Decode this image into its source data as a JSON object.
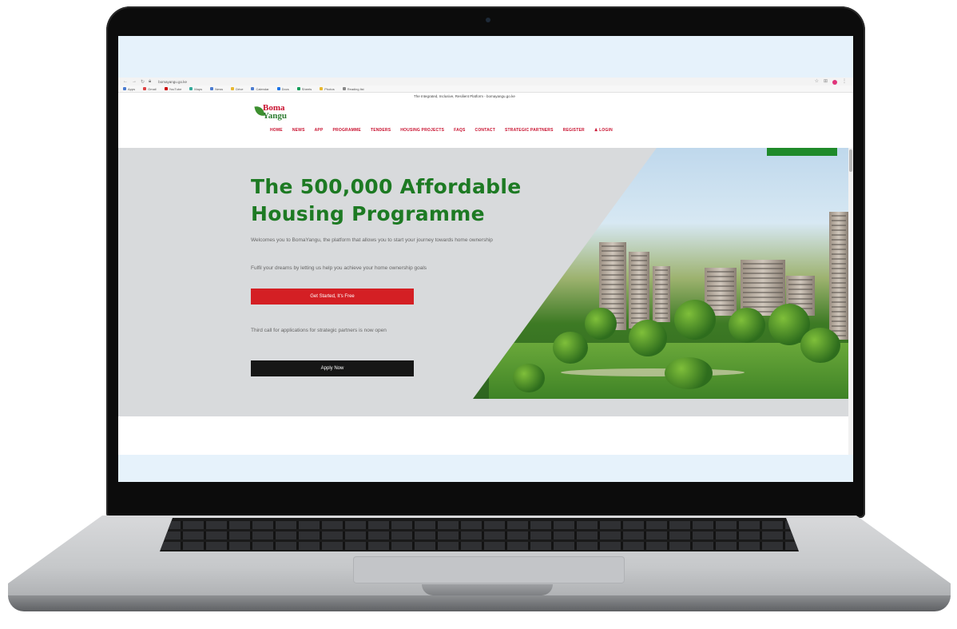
{
  "browser": {
    "url": "bomayangu.go.ke",
    "bookmarks": [
      "Apps",
      "Gmail",
      "YouTube",
      "Maps",
      "News",
      "Drive",
      "Calendar",
      "Docs",
      "Sheets",
      "Photos",
      "Reading list"
    ]
  },
  "site": {
    "announcement": "The Integrated, Inclusive, Resilient Platform - bomayangu.go.ke",
    "logo": {
      "line1": "Boma",
      "line2": "Yangu"
    },
    "nav": [
      "HOME",
      "NEWS",
      "APP",
      "PROGRAMME",
      "TENDERS",
      "HOUSING PROJECTS",
      "FAQS",
      "CONTACT",
      "STRATEGIC PARTNERS",
      "REGISTER",
      "LOGIN"
    ]
  },
  "hero": {
    "title": "The 500,000 Affordable Housing Programme",
    "text1": "Welcomes you to BomaYangu, the platform that allows you to start your journey towards home ownership",
    "text2": "Fulfil your dreams by letting us help you achieve your home ownership goals",
    "cta_primary": "Get Started, It's Free",
    "text3": "Third call for applications for strategic partners is now open",
    "cta_secondary": "Apply Now"
  },
  "colors": {
    "brand_green": "#1d7a23",
    "brand_red": "#c8102e",
    "cta_red": "#d41f24"
  }
}
